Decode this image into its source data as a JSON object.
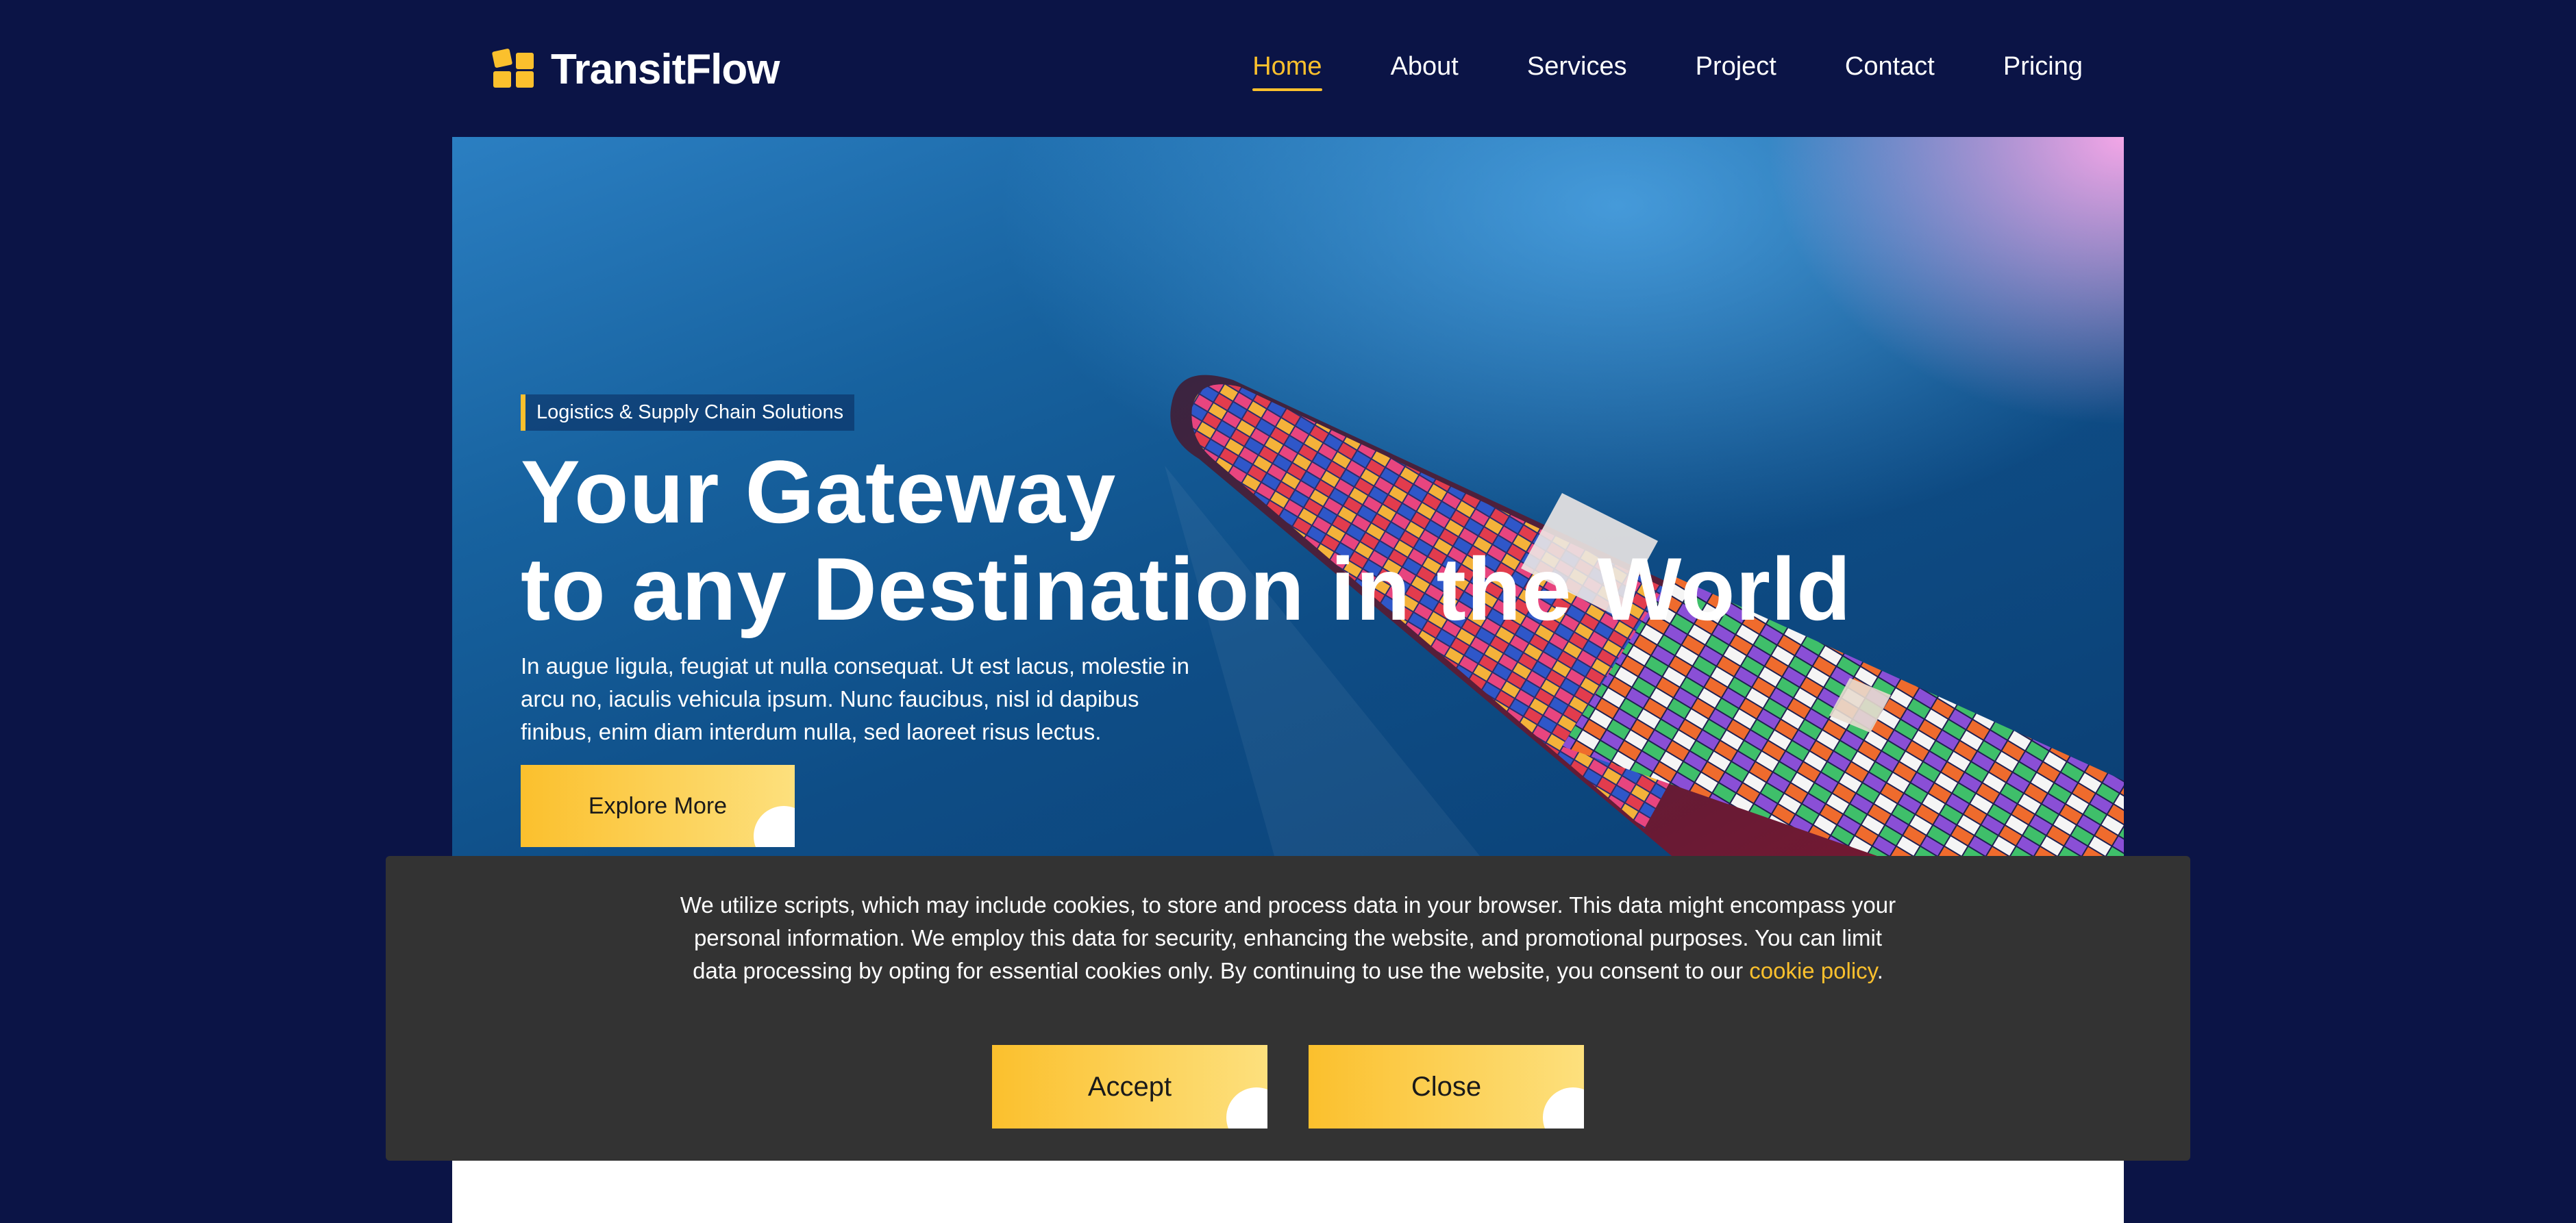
{
  "brand": {
    "name": "TransitFlow",
    "logo_icon": "boxes-logo-icon",
    "accent_color": "#fbc02d",
    "background_color": "#0b1446"
  },
  "nav": {
    "items": [
      {
        "label": "Home",
        "active": true
      },
      {
        "label": "About",
        "active": false
      },
      {
        "label": "Services",
        "active": false
      },
      {
        "label": "Project",
        "active": false
      },
      {
        "label": "Contact",
        "active": false
      },
      {
        "label": "Pricing",
        "active": false
      }
    ]
  },
  "hero": {
    "tagline": "Logistics & Supply Chain Solutions",
    "title_line1": "Your Gateway",
    "title_line2": "to any Destination in the World",
    "description": "In augue ligula, feugiat ut nulla consequat. Ut est lacus, molestie in arcu no, iaculis vehicula ipsum. Nunc faucibus, nisl id dapibus finibus, enim diam interdum nulla, sed laoreet risus lectus.",
    "button_label": "Explore More",
    "image": "container-ship-aerial-image"
  },
  "cookie": {
    "text_before_link": "We utilize scripts, which may include cookies, to store and process data in your browser. This data might encompass your personal information. We employ this data for security, enhancing the website, and promotional purposes. You can limit data processing by opting for essential cookies only. By continuing to use the website, you consent to our ",
    "link_label": "cookie policy",
    "text_after_link": ".",
    "accept_label": "Accept",
    "close_label": "Close",
    "background_color": "#333333"
  }
}
